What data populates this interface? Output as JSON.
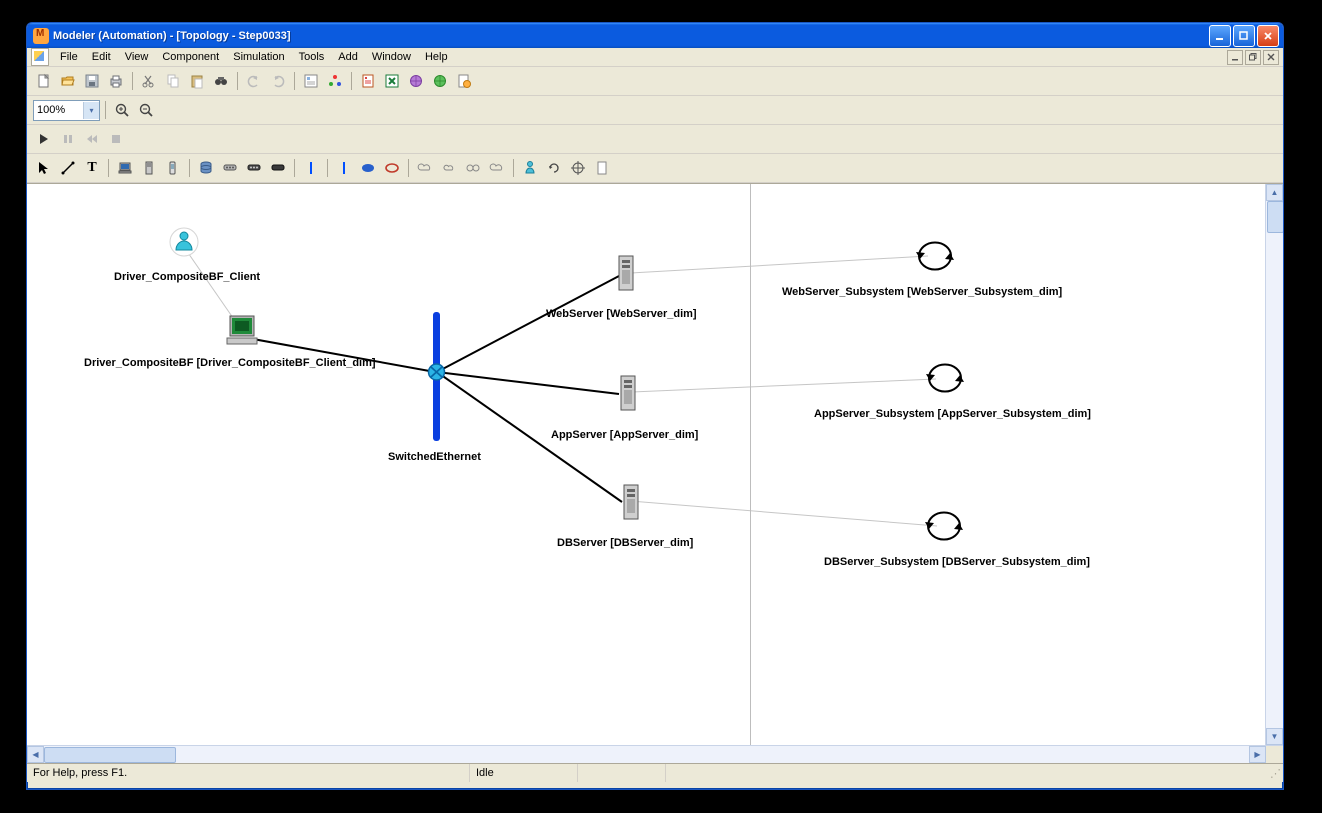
{
  "window": {
    "title": "Modeler (Automation) - [Topology - Step0033]"
  },
  "menu": {
    "file": "File",
    "edit": "Edit",
    "view": "View",
    "component": "Component",
    "simulation": "Simulation",
    "tools": "Tools",
    "add": "Add",
    "window": "Window",
    "help": "Help"
  },
  "zoom": {
    "value": "100%"
  },
  "topology": {
    "driver_client_label": "Driver_CompositeBF_Client",
    "driver_label": "Driver_CompositeBF [Driver_CompositeBF_Client_dim]",
    "switch_label": "SwitchedEthernet",
    "webserver_label": "WebServer [WebServer_dim]",
    "appserver_label": "AppServer [AppServer_dim]",
    "dbserver_label": "DBServer [DBServer_dim]",
    "web_sub_label": "WebServer_Subsystem [WebServer_Subsystem_dim]",
    "app_sub_label": "AppServer_Subsystem [AppServer_Subsystem_dim]",
    "db_sub_label": "DBServer_Subsystem [DBServer_Subsystem_dim]"
  },
  "status": {
    "help": "For Help, press F1.",
    "state": "Idle"
  }
}
